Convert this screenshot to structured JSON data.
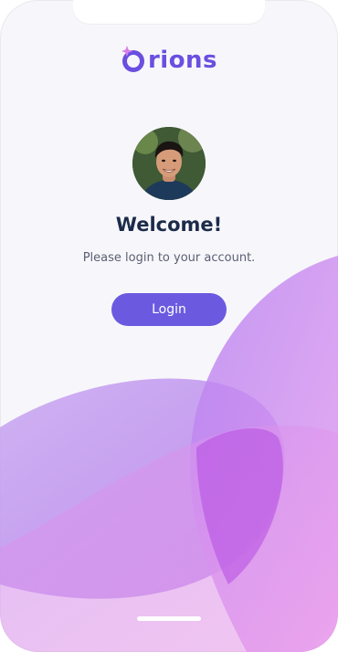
{
  "brand": {
    "name": "rions",
    "logo_icon": "orbit-ring-sparkle-icon",
    "colors": {
      "primary": "#6b5ae0",
      "accent": "#c07cf0",
      "heading": "#1c2b4a"
    }
  },
  "welcome": {
    "title": "Welcome!",
    "subtitle": "Please login to your account."
  },
  "avatar": {
    "icon": "user-avatar-photo"
  },
  "actions": {
    "login_label": "Login"
  }
}
